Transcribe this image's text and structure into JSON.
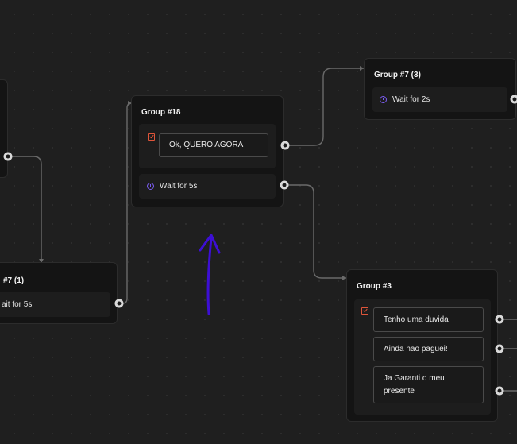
{
  "nodes": {
    "left_partial": {},
    "group7_1": {
      "title": "#7 (1)",
      "wait_label": "ait for 5s"
    },
    "group18": {
      "title": "Group #18",
      "button_label": "Ok, QUERO AGORA",
      "wait_label": "Wait for 5s"
    },
    "group7_3": {
      "title": "Group #7 (3)",
      "wait_label": "Wait for 2s"
    },
    "group3": {
      "title": "Group #3",
      "options": [
        "Tenho uma duvida",
        "Ainda nao paguei!",
        "Ja Garanti o meu presente"
      ]
    }
  },
  "annotation": {
    "arrow_color": "#3d0fd4"
  },
  "colors": {
    "canvas": "#1f1f1f",
    "node_bg": "#141414",
    "edge": "#6a6a6a",
    "clock_icon": "#7a5cf0",
    "choice_icon": "#e0553a"
  }
}
